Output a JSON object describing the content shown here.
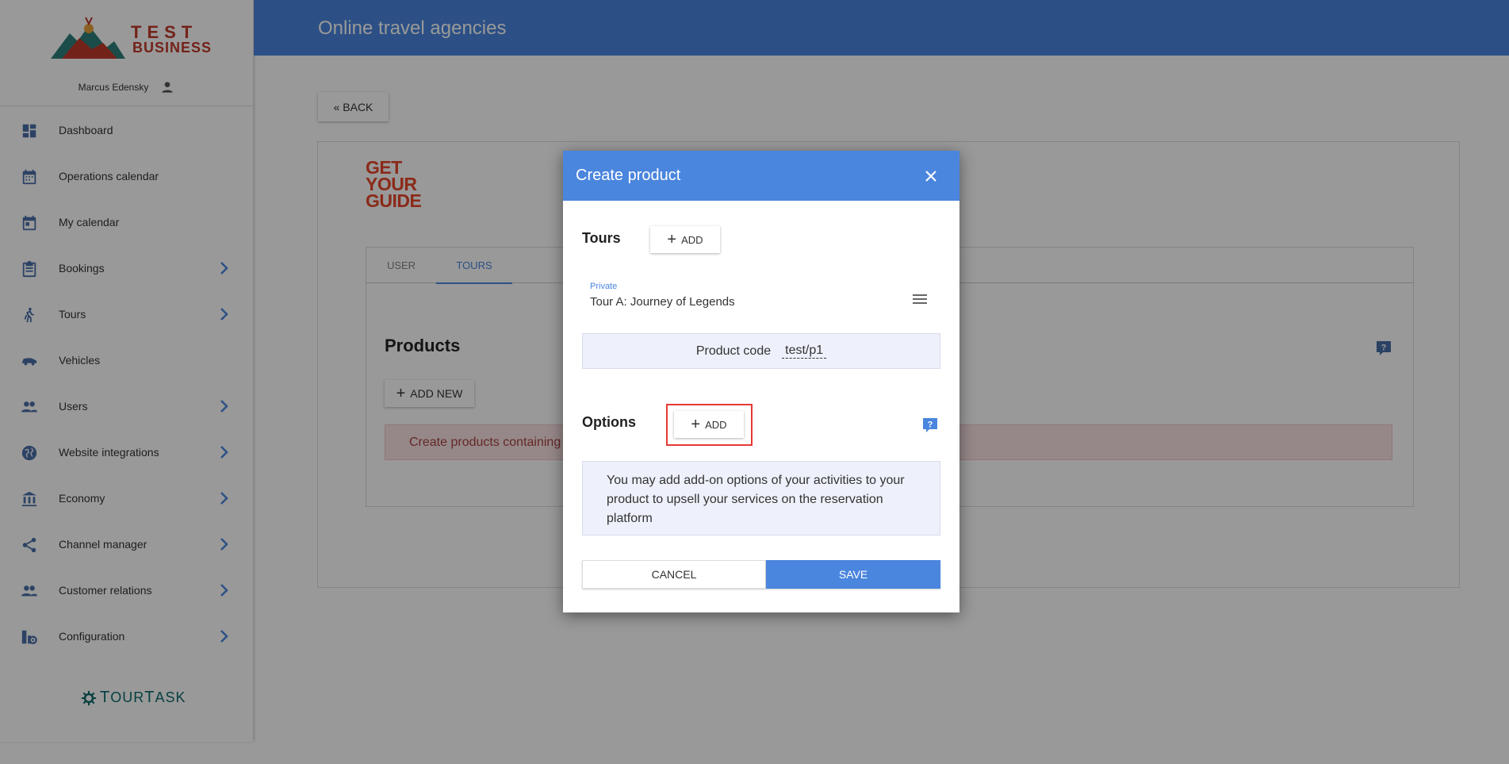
{
  "brand": {
    "name_top": "TEST",
    "name_bottom": "BUSINESS",
    "user_name": "Marcus Edensky",
    "footer_brand_prefix": "T",
    "footer_brand_mid": "OUR",
    "footer_brand_t": "T",
    "footer_brand_end": "ASK"
  },
  "sidebar": {
    "items": [
      {
        "label": "Dashboard",
        "icon": "dashboard-icon",
        "has_children": false
      },
      {
        "label": "Operations calendar",
        "icon": "calendar-icon",
        "has_children": false
      },
      {
        "label": "My calendar",
        "icon": "event-icon",
        "has_children": false
      },
      {
        "label": "Bookings",
        "icon": "clipboard-icon",
        "has_children": true
      },
      {
        "label": "Tours",
        "icon": "hiking-icon",
        "has_children": true
      },
      {
        "label": "Vehicles",
        "icon": "car-icon",
        "has_children": false
      },
      {
        "label": "Users",
        "icon": "people-icon",
        "has_children": true
      },
      {
        "label": "Website integrations",
        "icon": "globe-icon",
        "has_children": true
      },
      {
        "label": "Economy",
        "icon": "bank-icon",
        "has_children": true
      },
      {
        "label": "Channel manager",
        "icon": "share-icon",
        "has_children": true
      },
      {
        "label": "Customer relations",
        "icon": "people-icon",
        "has_children": true
      },
      {
        "label": "Configuration",
        "icon": "config-icon",
        "has_children": true
      }
    ]
  },
  "topbar": {
    "title": "Online travel agencies"
  },
  "main": {
    "back_label": "« BACK",
    "partner_logo": [
      "GET",
      "YOUR",
      "GUIDE"
    ],
    "tabs": [
      {
        "label": "USER",
        "active": false
      },
      {
        "label": "TOURS",
        "active": true
      }
    ],
    "products_title": "Products",
    "add_new_label": "ADD NEW",
    "alert_text": "Create products containing"
  },
  "modal": {
    "title": "Create product",
    "tours_title": "Tours",
    "tours_add_label": "ADD",
    "tour_item": {
      "kind": "Private",
      "name": "Tour A: Journey of Legends"
    },
    "product_code_label": "Product code",
    "product_code_value": "test/p1",
    "options_title": "Options",
    "options_add_label": "ADD",
    "info_text": "You may add add-on options of your activities to your product to upsell your services on the reservation platform",
    "cancel_label": "CANCEL",
    "save_label": "SAVE"
  },
  "colors": {
    "primary": "#4a85de",
    "brand_red": "#c0392b",
    "alert_bg": "#fbe3e4",
    "highlight": "#e53935"
  }
}
